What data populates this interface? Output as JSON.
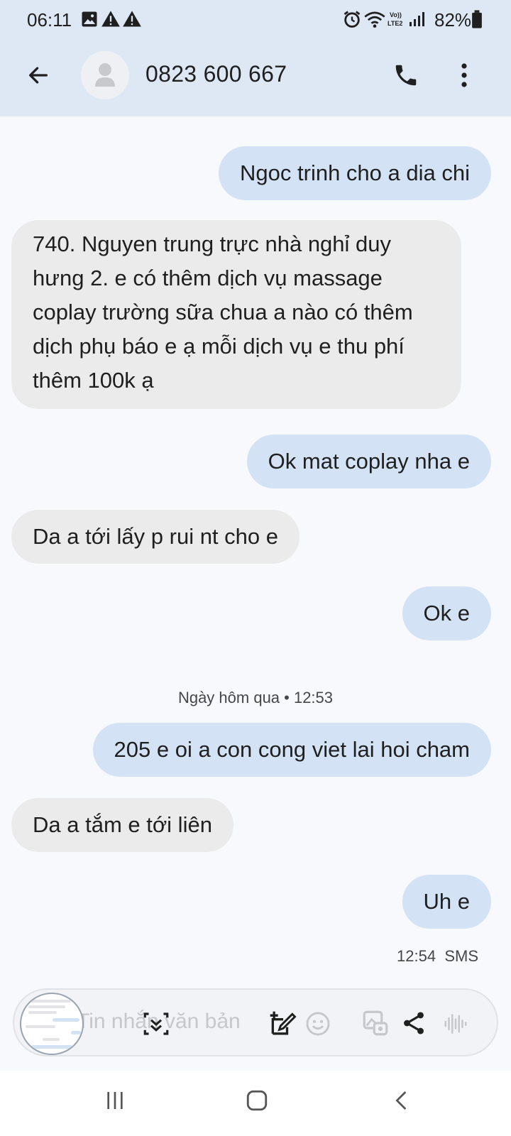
{
  "status_bar": {
    "time": "06:11",
    "battery_percent": "82%",
    "left_icons": [
      "image-icon",
      "warning-icon",
      "warning-icon"
    ],
    "right_icons": [
      "alarm-icon",
      "wifi-icon",
      "volte-icon",
      "signal-icon",
      "battery-icon"
    ]
  },
  "header": {
    "contact_name": "0823 600 667",
    "icons": [
      "back-arrow-icon",
      "avatar-icon",
      "phone-icon",
      "more-vert-icon"
    ]
  },
  "thread": {
    "messages": [
      {
        "direction": "outgoing",
        "text": "Ngoc trinh cho a dia chi"
      },
      {
        "direction": "incoming",
        "lines": [
          "740. Nguyen trung trực nhà nghỉ duy",
          "hưng 2. e có thêm dịch vụ massage",
          "coplay trường sữa chua a nào có thêm",
          "dịch phụ báo e ạ mỗi dịch vụ e thu phí",
          "thêm 100k ạ"
        ]
      },
      {
        "direction": "outgoing",
        "text": "Ok mat coplay nha e"
      },
      {
        "direction": "incoming",
        "text": "Da a tới lấy p rui nt cho e"
      },
      {
        "direction": "outgoing",
        "text": "Ok e"
      },
      {
        "direction": "outgoing",
        "text": "205 e oi a con cong viet lai hoi cham"
      },
      {
        "direction": "incoming",
        "text": "Da a tắm e tới liên"
      },
      {
        "direction": "outgoing",
        "text": "Uh e"
      }
    ],
    "date_separator": "Ngày hôm qua • 12:53",
    "last_meta": {
      "time": "12:54",
      "type": "SMS"
    }
  },
  "composer": {
    "placeholder": "Tin nhắn văn bản",
    "icons": [
      "screenshot-thumbnail",
      "scroll-capture-icon",
      "draw-icon",
      "emoji-icon",
      "gallery-icon",
      "share-icon",
      "voice-icon"
    ]
  },
  "nav_bar": {
    "icons": [
      "recent-apps-icon",
      "home-icon",
      "back-icon"
    ]
  },
  "colors": {
    "header_bg": "#dde8f4",
    "page_bg": "#f8f9fd",
    "outgoing_bubble": "#d3e3f5",
    "incoming_bubble": "#ebebec"
  }
}
